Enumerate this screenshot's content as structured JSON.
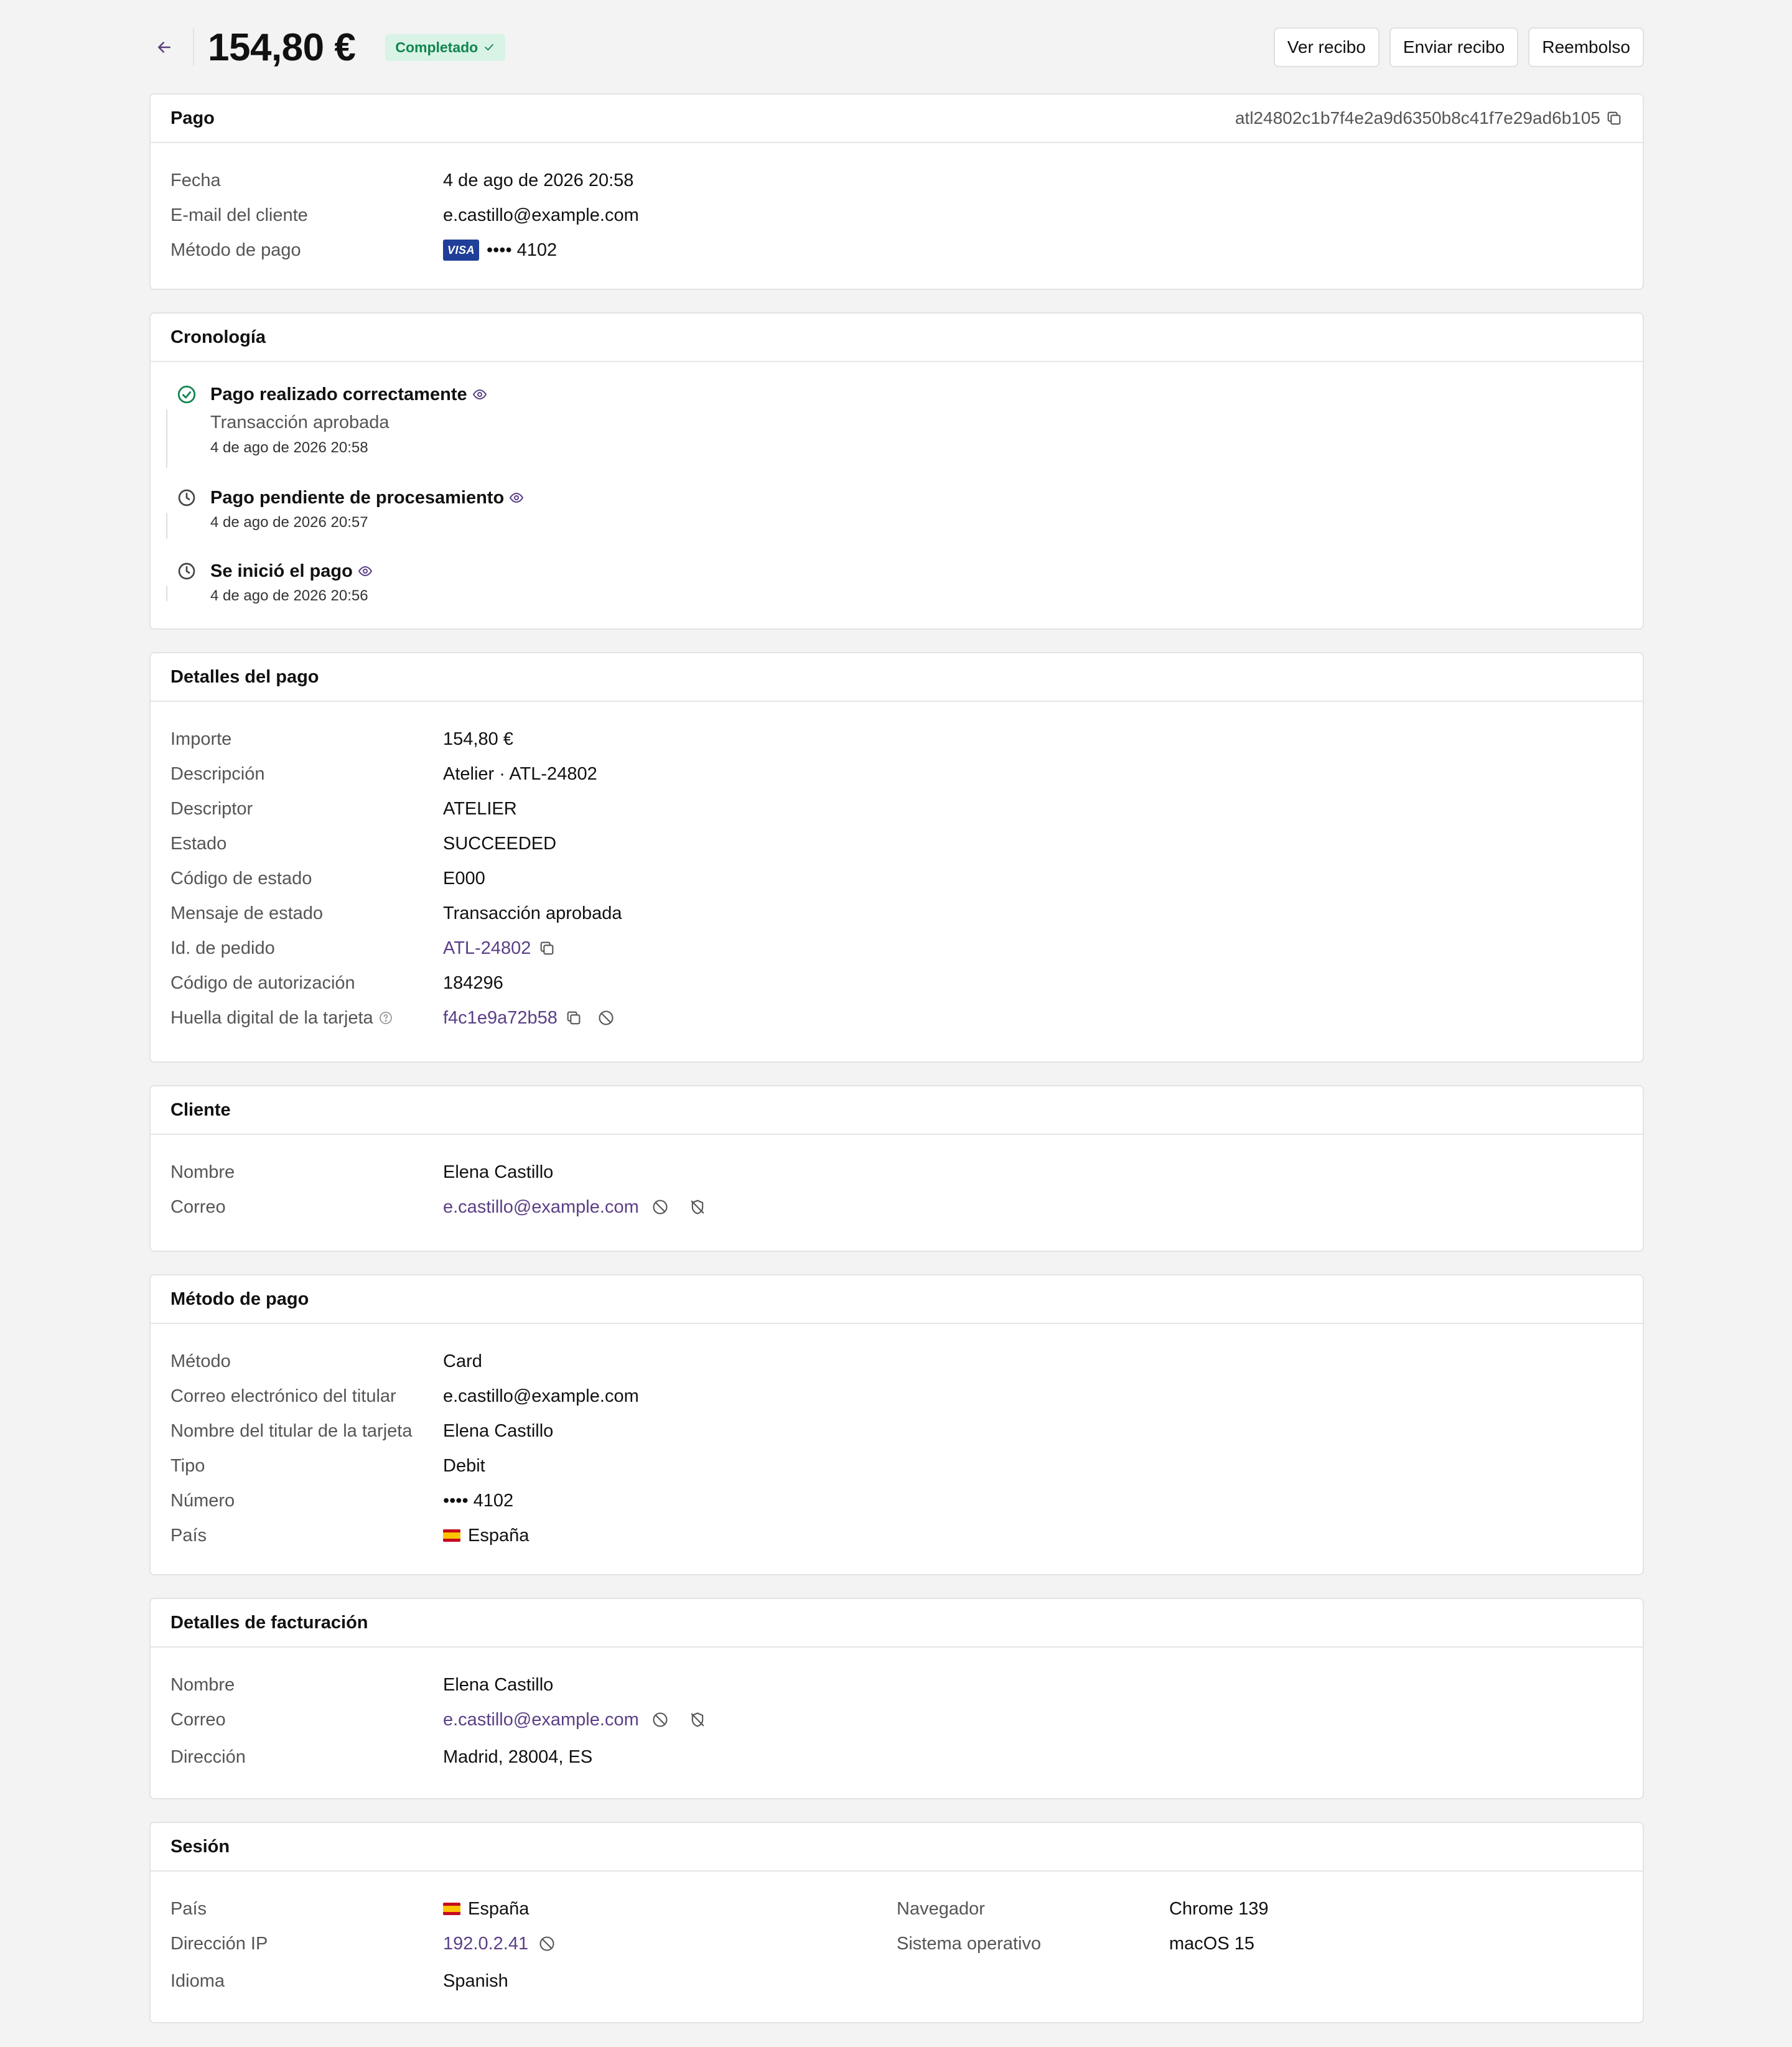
{
  "header": {
    "amount": "154,80 €",
    "status": "Completado",
    "actions": {
      "view_receipt": "Ver recibo",
      "send_receipt": "Enviar recibo",
      "refund": "Reembolso"
    }
  },
  "payment": {
    "title": "Pago",
    "id": "atl24802c1b7f4e2a9d6350b8c41f7e29ad6b105",
    "rows": {
      "date_label": "Fecha",
      "date_value": "4 de ago de 2026 20:58",
      "email_label": "E-mail del cliente",
      "email_value": "e.castillo@example.com",
      "method_label": "Método de pago",
      "card_brand": "VISA",
      "card_number": "•••• 4102"
    }
  },
  "timeline": {
    "title": "Cronología",
    "events": [
      {
        "title": "Pago realizado correctamente",
        "subtitle": "Transacción aprobada",
        "time": "4 de ago de 2026 20:58",
        "icon": "check-circle-icon"
      },
      {
        "title": "Pago pendiente de procesamiento",
        "time": "4 de ago de 2026 20:57",
        "icon": "clock-icon"
      },
      {
        "title": "Se inició el pago",
        "time": "4 de ago de 2026 20:56",
        "icon": "clock-icon"
      }
    ]
  },
  "payment_details": {
    "title": "Detalles del pago",
    "amount_label": "Importe",
    "amount_value": "154,80 €",
    "description_label": "Descripción",
    "description_value": "Atelier · ATL-24802",
    "descriptor_label": "Descriptor",
    "descriptor_value": "ATELIER",
    "state_label": "Estado",
    "state_value": "SUCCEEDED",
    "state_code_label": "Código de estado",
    "state_code_value": "E000",
    "state_msg_label": "Mensaje de estado",
    "state_msg_value": "Transacción aprobada",
    "order_id_label": "Id. de pedido",
    "order_id_value": "ATL-24802",
    "auth_code_label": "Código de autorización",
    "auth_code_value": "184296",
    "fingerprint_label": "Huella digital de la tarjeta",
    "fingerprint_value": "f4c1e9a72b58"
  },
  "customer": {
    "title": "Cliente",
    "name_label": "Nombre",
    "name_value": "Elena Castillo",
    "email_label": "Correo",
    "email_value": "e.castillo@example.com"
  },
  "method": {
    "title": "Método de pago",
    "method_label": "Método",
    "method_value": "Card",
    "holder_email_label": "Correo electrónico del titular",
    "holder_email_value": "e.castillo@example.com",
    "holder_name_label": "Nombre del titular de la tarjeta",
    "holder_name_value": "Elena Castillo",
    "type_label": "Tipo",
    "type_value": "Debit",
    "number_label": "Número",
    "number_value": "•••• 4102",
    "country_label": "País",
    "country_value": "España"
  },
  "billing": {
    "title": "Detalles de facturación",
    "name_label": "Nombre",
    "name_value": "Elena Castillo",
    "email_label": "Correo",
    "email_value": "e.castillo@example.com",
    "address_label": "Dirección",
    "address_value": "Madrid, 28004, ES"
  },
  "session": {
    "title": "Sesión",
    "country_label": "País",
    "country_value": "España",
    "ip_label": "Dirección IP",
    "ip_value": "192.0.2.41",
    "language_label": "Idioma",
    "language_value": "Spanish",
    "browser_label": "Navegador",
    "browser_value": "Chrome 139",
    "os_label": "Sistema operativo",
    "os_value": "macOS 15"
  },
  "colors": {
    "accent": "#5b3f86",
    "success": "#12854f",
    "success_bg": "#d9f3e6"
  }
}
